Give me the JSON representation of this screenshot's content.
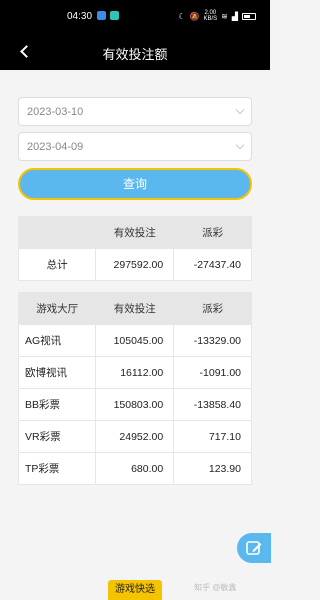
{
  "status_bar": {
    "time": "04:30",
    "network_speed": "2.00",
    "network_unit": "KB/S"
  },
  "header": {
    "title": "有效投注额"
  },
  "filters": {
    "start_date": "2023-03-10",
    "end_date": "2023-04-09",
    "query_label": "查询"
  },
  "summary": {
    "headers": [
      "",
      "有效投注",
      "派彩"
    ],
    "row": {
      "label": "总计",
      "bet": "297592.00",
      "payout": "-27437.40"
    }
  },
  "detail": {
    "headers": [
      "游戏大厅",
      "有效投注",
      "派彩"
    ],
    "rows": [
      {
        "hall": "AG视讯",
        "bet": "105045.00",
        "payout": "-13329.00"
      },
      {
        "hall": "欧博视讯",
        "bet": "16112.00",
        "payout": "-1091.00"
      },
      {
        "hall": "BB彩票",
        "bet": "150803.00",
        "payout": "-13858.40"
      },
      {
        "hall": "VR彩票",
        "bet": "24952.00",
        "payout": "717.10"
      },
      {
        "hall": "TP彩票",
        "bet": "680.00",
        "payout": "123.90"
      }
    ]
  },
  "footer": {
    "tab_label": "游戏快选",
    "watermark": "知乎 @敏鑫"
  },
  "colors": {
    "accent": "#5ab8ef",
    "highlight": "#f5c400",
    "bar": "#000000"
  },
  "icons": {
    "fab": "edit-icon",
    "back": "back-arrow-icon"
  }
}
